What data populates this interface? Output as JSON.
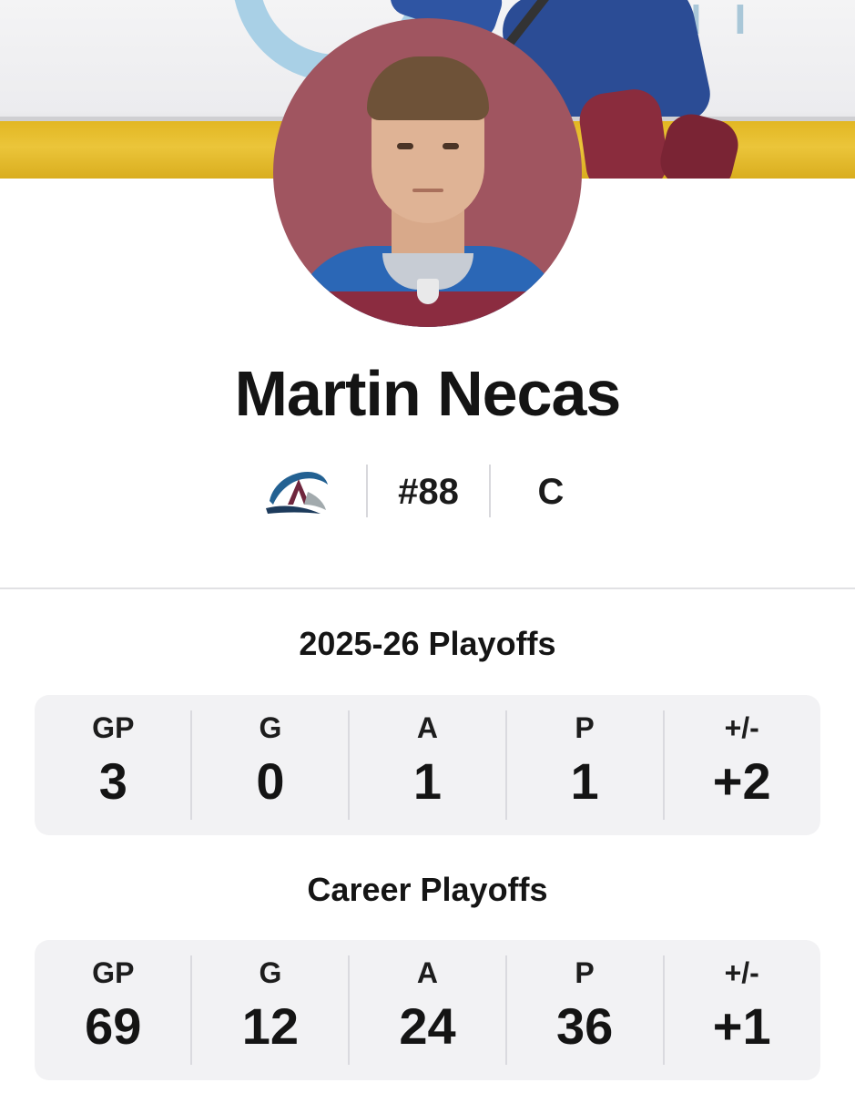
{
  "player": {
    "name": "Martin Necas",
    "number": "#88",
    "position": "C"
  },
  "team": {
    "logo_icon": "avalanche-logo-icon",
    "colors": {
      "burgundy": "#6f263d",
      "blue": "#236192",
      "silver": "#a2aaad"
    }
  },
  "hero": {
    "boards_color": "#e2b723"
  },
  "avatar": {
    "background": "#a05560"
  },
  "sections": [
    {
      "title": "2025-26 Playoffs",
      "stats": [
        {
          "label": "GP",
          "value": "3"
        },
        {
          "label": "G",
          "value": "0"
        },
        {
          "label": "A",
          "value": "1"
        },
        {
          "label": "P",
          "value": "1"
        },
        {
          "label": "+/-",
          "value": "+2"
        }
      ]
    },
    {
      "title": "Career Playoffs",
      "stats": [
        {
          "label": "GP",
          "value": "69"
        },
        {
          "label": "G",
          "value": "12"
        },
        {
          "label": "A",
          "value": "24"
        },
        {
          "label": "P",
          "value": "36"
        },
        {
          "label": "+/-",
          "value": "+1"
        }
      ]
    }
  ]
}
